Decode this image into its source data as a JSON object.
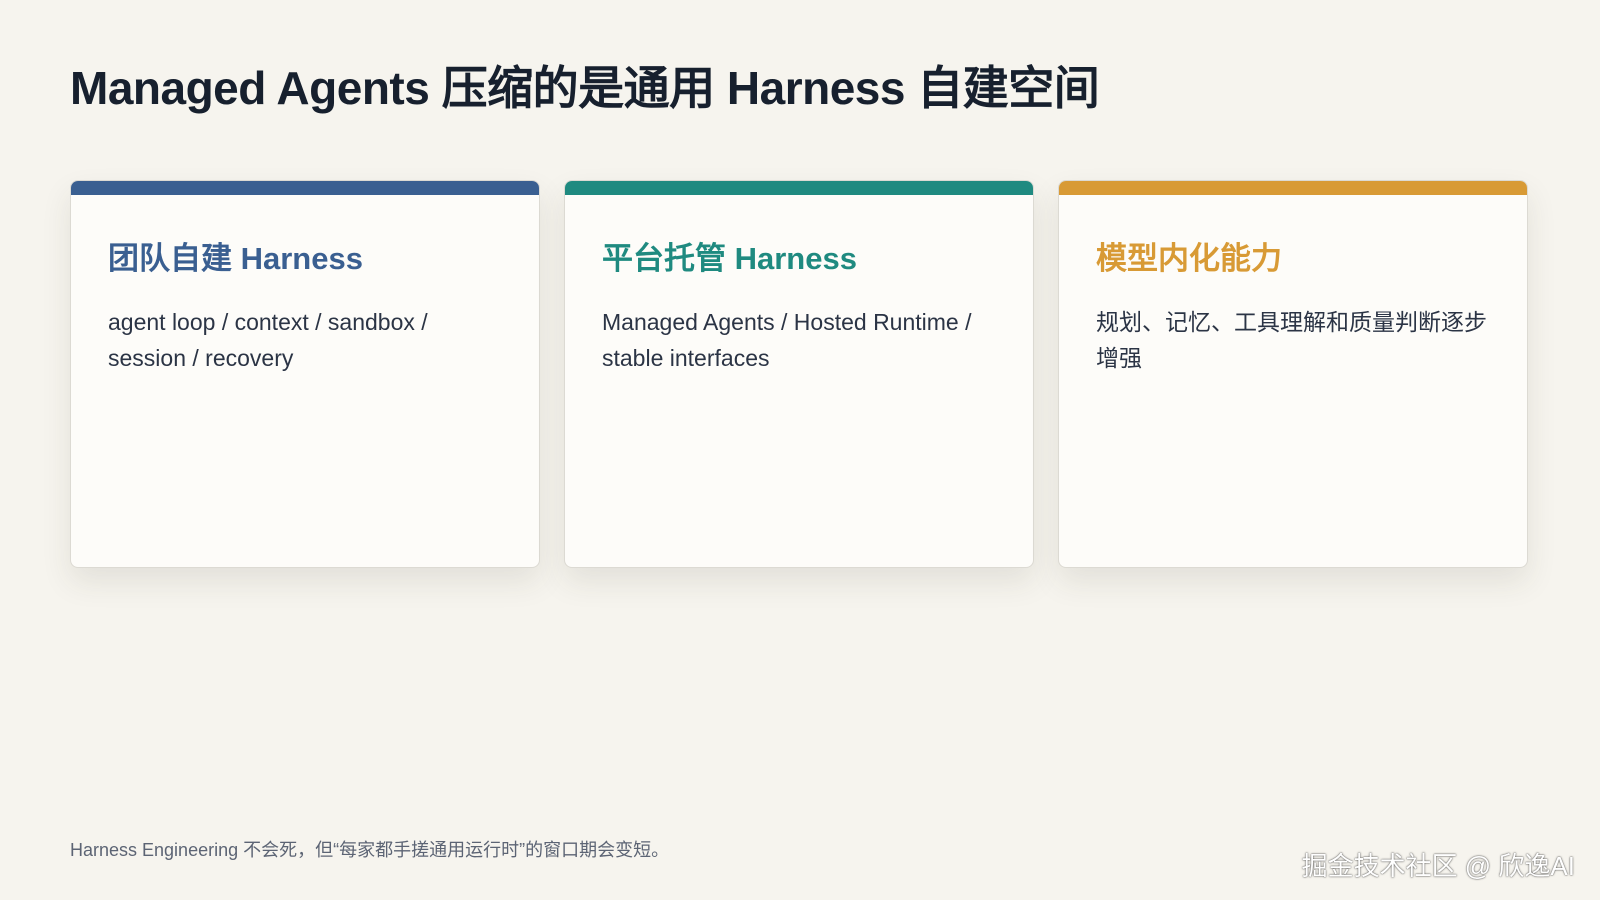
{
  "header": {
    "title": "Managed Agents 压缩的是通用 Harness 自建空间"
  },
  "cards": [
    {
      "title": "团队自建 Harness",
      "body": "agent loop / context / sandbox / session / recovery",
      "accent_color": "#3a5f91"
    },
    {
      "title": "平台托管 Harness",
      "body": "Managed Agents / Hosted Runtime / stable interfaces",
      "accent_color": "#1f8a80"
    },
    {
      "title": "模型内化能力",
      "body": "规划、记忆、工具理解和质量判断逐步增强",
      "accent_color": "#d89a35"
    }
  ],
  "footer": {
    "note": "Harness Engineering 不会死，但“每家都手搓通用运行时”的窗口期会变短。",
    "watermark": "掘金技术社区 @ 欣逸AI"
  }
}
